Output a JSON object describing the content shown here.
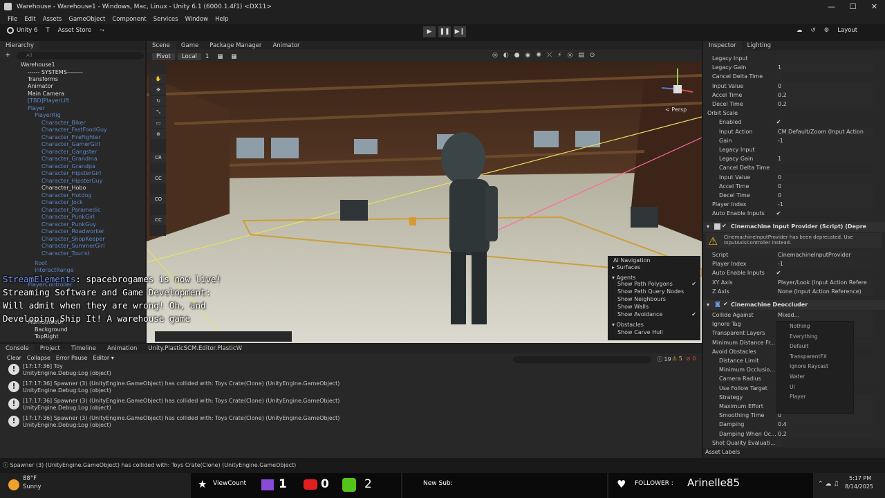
{
  "window": {
    "title": "Warehouse - Warehouse1 - Windows, Mac, Linux - Unity 6.1 (6000.1.4f1) <DX11>",
    "controls": [
      "—",
      "☐",
      "✕"
    ]
  },
  "menu": [
    "File",
    "Edit",
    "Assets",
    "GameObject",
    "Component",
    "Services",
    "Window",
    "Help"
  ],
  "toolbar": {
    "unity_label": "Unity 6",
    "account_label": "T",
    "asset_store": "Asset Store",
    "layout": "Layout"
  },
  "hierarchy": {
    "tab": "Hierarchy",
    "search_placeholder": "All",
    "items": [
      {
        "label": "Warehouse1",
        "style": "white"
      },
      {
        "label": "------ SYSTEMS--------",
        "style": "white"
      },
      {
        "label": "Transforms",
        "style": "white"
      },
      {
        "label": "Animator",
        "style": "white"
      },
      {
        "label": "Main Camera",
        "style": "white"
      },
      {
        "label": "[TBD]PlayerLift",
        "style": "blue"
      },
      {
        "label": "Player",
        "style": "blue"
      },
      {
        "label": "PlayerRig",
        "style": "blue"
      },
      {
        "label": "Character_Biker",
        "style": "blue"
      },
      {
        "label": "Character_FastFoodGuy",
        "style": "blue"
      },
      {
        "label": "Character_FireFighter",
        "style": "blue"
      },
      {
        "label": "Character_GamerGirl",
        "style": "blue"
      },
      {
        "label": "Character_Gangster",
        "style": "blue"
      },
      {
        "label": "Character_Grandma",
        "style": "blue"
      },
      {
        "label": "Character_Grandpa",
        "style": "blue"
      },
      {
        "label": "Character_HipsterGirl",
        "style": "blue"
      },
      {
        "label": "Character_HipsterGuy",
        "style": "blue"
      },
      {
        "label": "Character_Hobo",
        "style": "white"
      },
      {
        "label": "Character_Hotdog",
        "style": "blue"
      },
      {
        "label": "Character_Jock",
        "style": "blue"
      },
      {
        "label": "Character_Paramedic",
        "style": "blue"
      },
      {
        "label": "Character_PunkGirl",
        "style": "blue"
      },
      {
        "label": "Character_PunkGuy",
        "style": "blue"
      },
      {
        "label": "Character_Roadworker",
        "style": "blue"
      },
      {
        "label": "Character_ShopKeeper",
        "style": "blue"
      },
      {
        "label": "Character_SummerGirl",
        "style": "blue"
      },
      {
        "label": "Character_Tourist",
        "style": "blue"
      },
      {
        "label": "Root",
        "style": "blue"
      },
      {
        "label": "InteractRange",
        "style": "blue"
      },
      {
        "label": "PlayerController",
        "style": "blue"
      },
      {
        "label": "MainGameUI",
        "style": "white"
      },
      {
        "label": "Background",
        "style": "white"
      },
      {
        "label": "TopRight",
        "style": "white"
      }
    ]
  },
  "scene": {
    "tabs": [
      "Scene",
      "Game",
      "Package Manager",
      "Animator"
    ],
    "pivot": "Pivot",
    "local": "Local",
    "num": "1",
    "persp": "< Persp",
    "gizmo_labels": [
      "CR",
      "CC",
      "CO",
      "CC"
    ],
    "overlay": {
      "title": "AI Navigation",
      "surfaces": "Surfaces",
      "agents": "Agents",
      "items": [
        {
          "label": "Show Path Polygons",
          "checked": "✔"
        },
        {
          "label": "Show Path Query Nodes",
          "checked": ""
        },
        {
          "label": "Show Neighbours",
          "checked": ""
        },
        {
          "label": "Show Walls",
          "checked": ""
        },
        {
          "label": "Show Avoidance",
          "checked": "✔"
        }
      ],
      "obstacles": "Obstacles",
      "carve": "Show Carve Hull"
    }
  },
  "stream_overlay": {
    "brand": "StreamElements",
    "message": ": spacebrogames is now live! Streaming Software and Game Development: Will admit when they are wrong! Oh, and Developing Ship It! A warehouse game"
  },
  "console": {
    "tabs": [
      "Console",
      "Project",
      "Timeline",
      "Animation",
      "Unity.PlasticSCM.Editor.PlasticW"
    ],
    "buttons": [
      "Clear",
      "Collapse",
      "Error Pause",
      "Editor ▾"
    ],
    "counts": {
      "info": "19",
      "warn": "5",
      "error": "0"
    },
    "entries": [
      {
        "l1": "[17:17:36] Toy",
        "l2": "UnityEngine.Debug:Log (object)"
      },
      {
        "l1": "[17:17:36] Spawner (3) (UnityEngine.GameObject) has collided with: Toys Crate(Clone) (UnityEngine.GameObject)",
        "l2": "UnityEngine.Debug:Log (object)"
      },
      {
        "l1": "[17:17:36] Spawner (3) (UnityEngine.GameObject) has collided with: Toys Crate(Clone) (UnityEngine.GameObject)",
        "l2": "UnityEngine.Debug:Log (object)"
      },
      {
        "l1": "[17:17:36] Spawner (3) (UnityEngine.GameObject) has collided with: Toys Crate(Clone) (UnityEngine.GameObject)",
        "l2": "UnityEngine.Debug:Log (object)"
      }
    ],
    "status": "Spawner (3) (UnityEngine.GameObject) has collided with: Toys Crate(Clone) (UnityEngine.GameObject)"
  },
  "inspector": {
    "tabs": [
      "Inspector",
      "Lighting"
    ],
    "top_props": [
      {
        "label": "Legacy Input",
        "value": "",
        "indent": false,
        "type": "field"
      },
      {
        "label": "Legacy Gain",
        "value": "1",
        "indent": false,
        "type": "field"
      },
      {
        "label": "Cancel Delta Time",
        "value": "",
        "indent": false,
        "type": "check"
      },
      {
        "label": "Input Value",
        "value": "0",
        "indent": false,
        "type": "field"
      },
      {
        "label": "Accel Time",
        "value": "0.2",
        "indent": false,
        "type": "field"
      },
      {
        "label": "Decel Time",
        "value": "0.2",
        "indent": false,
        "type": "field"
      },
      {
        "label": "Orbit Scale",
        "value": "",
        "indent": false,
        "type": "header"
      },
      {
        "label": "Enabled",
        "value": "✔",
        "indent": true,
        "type": "check"
      },
      {
        "label": "Input Action",
        "value": "CM Default/Zoom (Input Action",
        "indent": true,
        "type": "field"
      },
      {
        "label": "Gain",
        "value": "-1",
        "indent": true,
        "type": "field"
      },
      {
        "label": "Legacy Input",
        "value": "",
        "indent": true,
        "type": "field"
      },
      {
        "label": "Legacy Gain",
        "value": "1",
        "indent": true,
        "type": "field"
      },
      {
        "label": "Cancel Delta Time",
        "value": "",
        "indent": true,
        "type": "check"
      },
      {
        "label": "Input Value",
        "value": "0",
        "indent": true,
        "type": "field"
      },
      {
        "label": "Accel Time",
        "value": "0",
        "indent": true,
        "type": "field"
      },
      {
        "label": "Decel Time",
        "value": "0",
        "indent": true,
        "type": "field"
      },
      {
        "label": "Player Index",
        "value": "-1",
        "indent": false,
        "type": "field"
      },
      {
        "label": "Auto Enable Inputs",
        "value": "✔",
        "indent": false,
        "type": "check"
      }
    ],
    "provider": {
      "title": "Cinemachine Input Provider (Script) (Depre",
      "warning": "CinemachineInputProvider has been deprecated. Use InputAxisController instead.",
      "props": [
        {
          "label": "Script",
          "value": "CinemachineInputProvider",
          "type": "field"
        },
        {
          "label": "Player Index",
          "value": "-1",
          "type": "field"
        },
        {
          "label": "Auto Enable Inputs",
          "value": "✔",
          "type": "check"
        },
        {
          "label": "XY Axis",
          "value": "Player/Look (Input Action Refere",
          "type": "field"
        },
        {
          "label": "Z Axis",
          "value": "None (Input Action Reference)",
          "type": "field"
        }
      ]
    },
    "deoccluder": {
      "title": "Cinemachine Deoccluder",
      "props": [
        {
          "label": "Collide Against",
          "value": "Mixed...",
          "indent": false,
          "type": "field"
        },
        {
          "label": "Ignore Tag",
          "value": "",
          "indent": false,
          "type": "field"
        },
        {
          "label": "Transparent Layers",
          "value": "Nothing",
          "indent": false,
          "type": "field"
        },
        {
          "label": "Minimum Distance Fr...",
          "value": "0.3",
          "indent": false,
          "type": "field"
        },
        {
          "label": "Avoid Obstacles",
          "value": "✔",
          "indent": false,
          "type": "check"
        },
        {
          "label": "Distance Limit",
          "value": "0",
          "indent": true,
          "type": "field"
        },
        {
          "label": "Minimum Occlusio...",
          "value": "0",
          "indent": true,
          "type": "field"
        },
        {
          "label": "Camera Radius",
          "value": "0.4",
          "indent": true,
          "type": "field"
        },
        {
          "label": "Use Follow Target",
          "value": "",
          "indent": true,
          "type": "check"
        },
        {
          "label": "Strategy",
          "value": "Pull Camera Forward",
          "indent": true,
          "type": "field"
        },
        {
          "label": "Maximum Effort",
          "value": "4",
          "indent": true,
          "type": "field"
        },
        {
          "label": "Smoothing Time",
          "value": "0",
          "indent": true,
          "type": "field"
        },
        {
          "label": "Damping",
          "value": "0.4",
          "indent": true,
          "type": "field"
        },
        {
          "label": "Damping When Oc...",
          "value": "0.2",
          "indent": true,
          "type": "field"
        },
        {
          "label": "Shot Quality Evaluati...",
          "value": "",
          "indent": false,
          "type": "check"
        }
      ]
    },
    "layer_dropdown": [
      "Nothing",
      "Everything",
      "Default",
      "TransparentFX",
      "Ignore Raycast",
      "Water",
      "UI",
      "Player"
    ],
    "asset_labels": "Asset Labels"
  },
  "taskbar": {
    "weather_temp": "88°F",
    "weather_desc": "Sunny",
    "viewcount_label": "ViewCount",
    "twitch_count": "1",
    "youtube_count": "0",
    "kick_count": "2",
    "new_sub": "New Sub:",
    "follower_label": "FOLLOWER :",
    "follower_name": "Arinelle85",
    "time": "5:17 PM",
    "date": "8/14/2025"
  }
}
